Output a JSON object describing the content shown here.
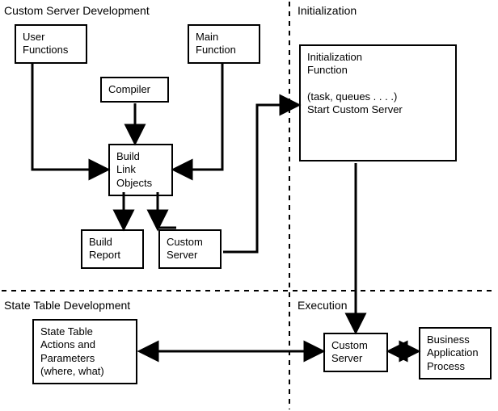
{
  "sections": {
    "custom_server_dev": "Custom Server Development",
    "initialization": "Initialization",
    "state_table_dev": "State Table Development",
    "execution": "Execution"
  },
  "boxes": {
    "user_functions": "User\nFunctions",
    "main_function": "Main\nFunction",
    "compiler": "Compiler",
    "build_link_objects": "Build\nLink\nObjects",
    "build_report": "Build\nReport",
    "custom_server_top": "Custom\nServer",
    "init_function": "Initialization\nFunction\n\n(task, queues . . . .)\nStart Custom Server",
    "state_table_actions": "State Table\nActions and\nParameters\n(where, what)",
    "custom_server_bottom": "Custom\nServer",
    "business_app": "Business\nApplication\nProcess"
  }
}
